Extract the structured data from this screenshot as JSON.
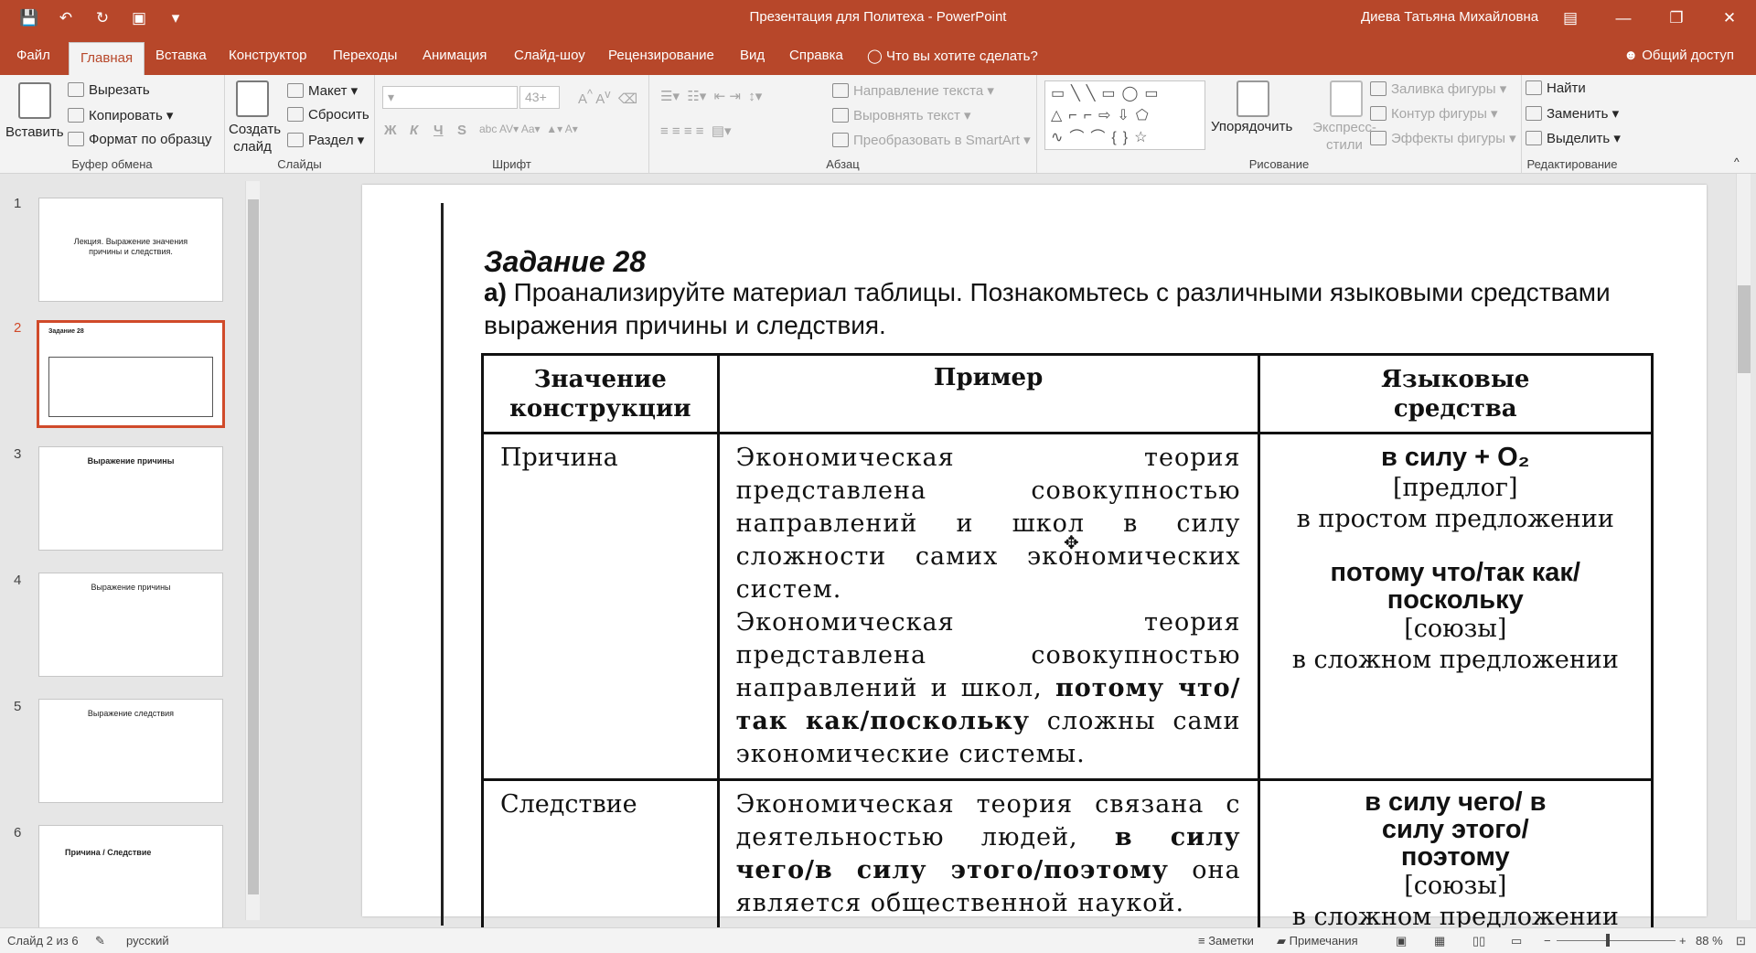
{
  "app": {
    "title": "Презентация для Политеха  -  PowerPoint",
    "user": "Диева Татьяна Михайловна",
    "share": "Общий доступ"
  },
  "qat_icons": [
    "save-icon",
    "undo-icon",
    "redo-icon",
    "present-icon",
    "customize-icon"
  ],
  "tabs": [
    "Файл",
    "Главная",
    "Вставка",
    "Конструктор",
    "Переходы",
    "Анимация",
    "Слайд-шоу",
    "Рецензирование",
    "Вид",
    "Справка"
  ],
  "tell_me": "Что вы хотите сделать?",
  "ribbon": {
    "clipboard": {
      "paste": "Вставить",
      "cut": "Вырезать",
      "copy": "Копировать",
      "format": "Формат по образцу",
      "label": "Буфер обмена"
    },
    "slides": {
      "new": "Создать слайд",
      "layout": "Макет",
      "reset": "Сбросить",
      "section": "Раздел",
      "label": "Слайды"
    },
    "font": {
      "size": "43+",
      "bold": "Ж",
      "italic": "К",
      "underline": "Ч",
      "strike": "S",
      "label": "Шрифт"
    },
    "paragraph": {
      "direction": "Направление текста",
      "align": "Выровнять текст",
      "smartart": "Преобразовать в SmartArt",
      "label": "Абзац"
    },
    "drawing": {
      "arrange": "Упорядочить",
      "styles": "Экспресс-стили",
      "fill": "Заливка фигуры",
      "outline": "Контур фигуры",
      "effects": "Эффекты фигуры",
      "label": "Рисование"
    },
    "editing": {
      "find": "Найти",
      "replace": "Заменить",
      "select": "Выделить",
      "label": "Редактирование"
    }
  },
  "thumbnails": [
    {
      "num": "1",
      "text": "Лекция. Выражение значения причины и следствия."
    },
    {
      "num": "2",
      "text": "Задание 28"
    },
    {
      "num": "3",
      "text": "Выражение причины"
    },
    {
      "num": "4",
      "text": "Выражение причины"
    },
    {
      "num": "5",
      "text": "Выражение следствия"
    },
    {
      "num": "6",
      "text": "Причина / Следствие"
    }
  ],
  "slide": {
    "heading": "Задание 28",
    "task_letter": "а)",
    "task_text": " Проанализируйте материал таблицы. Познакомьтесь с различными языковыми средствами выражения причины и следствия.",
    "table": {
      "headers": [
        "Значение конструкции",
        "Пример",
        "Языковые средства"
      ],
      "row1": {
        "meaning": "Причина",
        "ex1": "Экономическая теория представлена совокупностью направлений и школ в силу сложности самих экономических систем.",
        "ex2_a": "Экономическая теория представлена совокупностью направлений и школ, ",
        "ex2_b": "потому что/так как/поскольку",
        "ex2_c": " сложны сами экономические системы.",
        "m1": "в силу + O₂",
        "m2": "[предлог]",
        "m3": "в простом предложении",
        "m4": "потому что/так как/ поскольку",
        "m5": "[союзы]",
        "m6": "в сложном предложении"
      },
      "row2": {
        "meaning": "Следствие",
        "ex_a": "Экономическая теория связана с деятельностью людей, ",
        "ex_b": "в силу чего/в силу этого/поэтому",
        "ex_c": " она является общественной наукой.",
        "m1": "в силу чего/ в силу этого/ поэтому",
        "m2": "[союзы]",
        "m3": "в сложном предложении"
      }
    }
  },
  "status": {
    "slide": "Слайд 2 из 6",
    "lang": "русский",
    "notes": "Заметки",
    "comments": "Примечания",
    "zoom": "88 %"
  }
}
